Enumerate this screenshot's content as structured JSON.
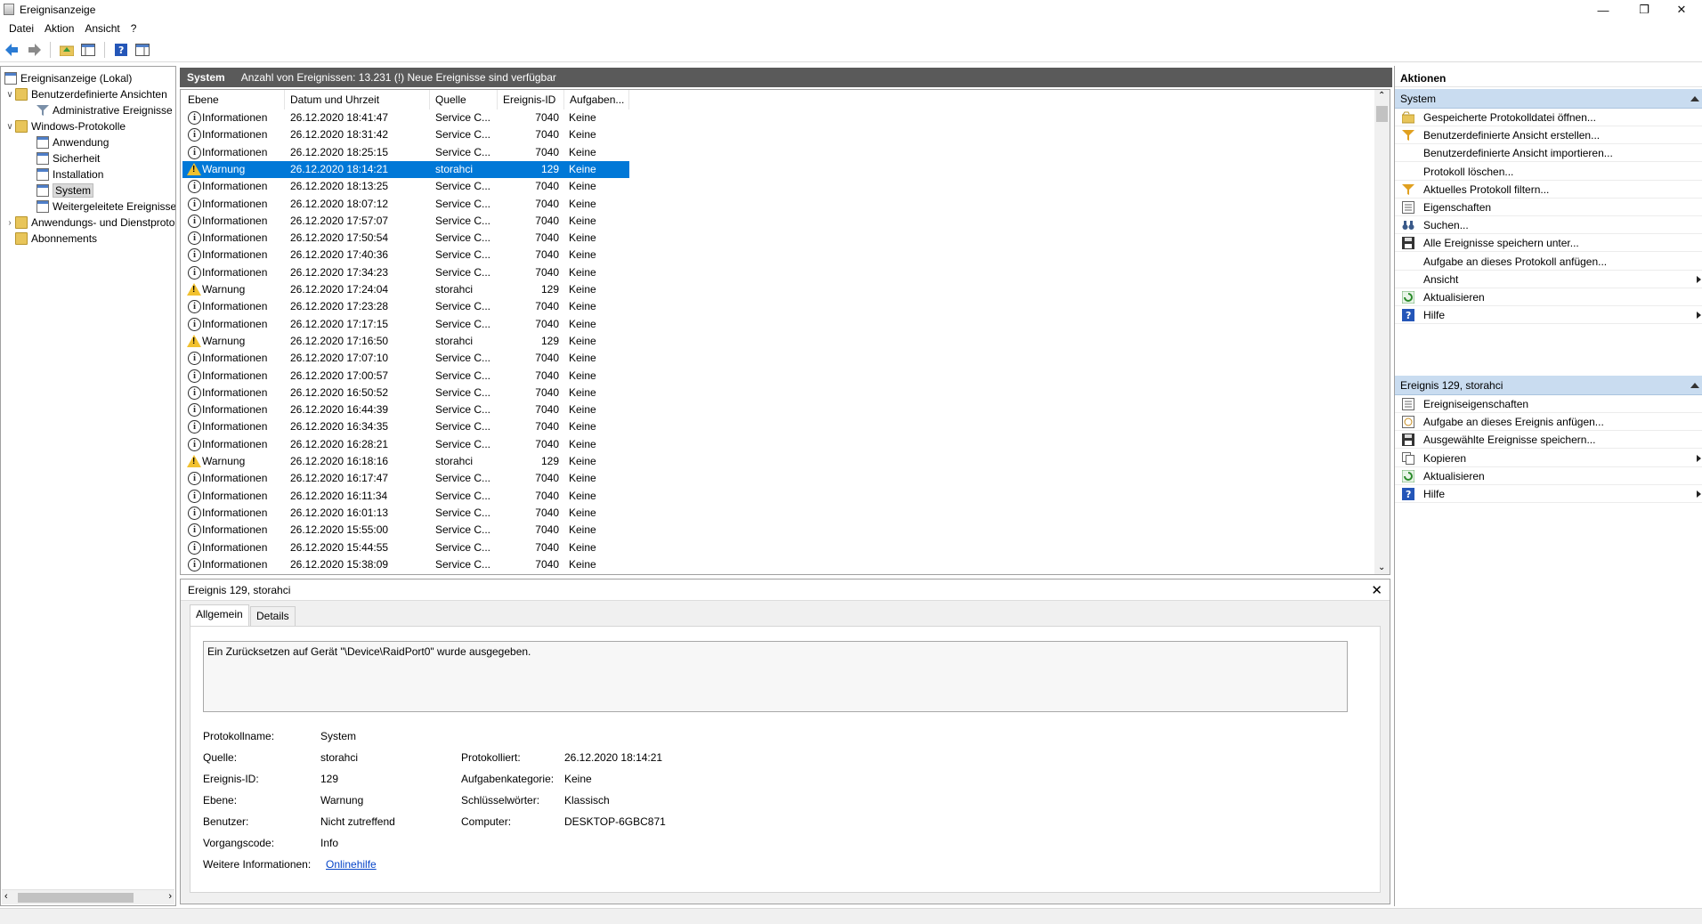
{
  "window": {
    "title": "Ereignisanzeige"
  },
  "menu": [
    "Datei",
    "Aktion",
    "Ansicht",
    "?"
  ],
  "tree": {
    "items": [
      {
        "label": "Ereignisanzeige (Lokal)"
      },
      {
        "label": "Benutzerdefinierte Ansichten"
      },
      {
        "label": "Administrative Ereignisse"
      },
      {
        "label": "Windows-Protokolle"
      },
      {
        "label": "Anwendung"
      },
      {
        "label": "Sicherheit"
      },
      {
        "label": "Installation"
      },
      {
        "label": "System"
      },
      {
        "label": "Weitergeleitete Ereignisse"
      },
      {
        "label": "Anwendungs- und Dienstprotokolle"
      },
      {
        "label": "Abonnements"
      }
    ]
  },
  "center": {
    "log_name": "System",
    "summary": "Anzahl von Ereignissen: 13.231 (!) Neue Ereignisse sind verfügbar"
  },
  "table": {
    "headers": [
      "Ebene",
      "Datum und Uhrzeit",
      "Quelle",
      "Ereignis-ID",
      "Aufgaben..."
    ],
    "rows": [
      {
        "level": "Informationen",
        "type": "info",
        "date": "26.12.2020 18:41:47",
        "source": "Service C...",
        "id": "7040",
        "task": "Keine"
      },
      {
        "level": "Informationen",
        "type": "info",
        "date": "26.12.2020 18:31:42",
        "source": "Service C...",
        "id": "7040",
        "task": "Keine"
      },
      {
        "level": "Informationen",
        "type": "info",
        "date": "26.12.2020 18:25:15",
        "source": "Service C...",
        "id": "7040",
        "task": "Keine"
      },
      {
        "level": "Warnung",
        "type": "warn",
        "date": "26.12.2020 18:14:21",
        "source": "storahci",
        "id": "129",
        "task": "Keine",
        "selected": true
      },
      {
        "level": "Informationen",
        "type": "info",
        "date": "26.12.2020 18:13:25",
        "source": "Service C...",
        "id": "7040",
        "task": "Keine"
      },
      {
        "level": "Informationen",
        "type": "info",
        "date": "26.12.2020 18:07:12",
        "source": "Service C...",
        "id": "7040",
        "task": "Keine"
      },
      {
        "level": "Informationen",
        "type": "info",
        "date": "26.12.2020 17:57:07",
        "source": "Service C...",
        "id": "7040",
        "task": "Keine"
      },
      {
        "level": "Informationen",
        "type": "info",
        "date": "26.12.2020 17:50:54",
        "source": "Service C...",
        "id": "7040",
        "task": "Keine"
      },
      {
        "level": "Informationen",
        "type": "info",
        "date": "26.12.2020 17:40:36",
        "source": "Service C...",
        "id": "7040",
        "task": "Keine"
      },
      {
        "level": "Informationen",
        "type": "info",
        "date": "26.12.2020 17:34:23",
        "source": "Service C...",
        "id": "7040",
        "task": "Keine"
      },
      {
        "level": "Warnung",
        "type": "warn",
        "date": "26.12.2020 17:24:04",
        "source": "storahci",
        "id": "129",
        "task": "Keine"
      },
      {
        "level": "Informationen",
        "type": "info",
        "date": "26.12.2020 17:23:28",
        "source": "Service C...",
        "id": "7040",
        "task": "Keine"
      },
      {
        "level": "Informationen",
        "type": "info",
        "date": "26.12.2020 17:17:15",
        "source": "Service C...",
        "id": "7040",
        "task": "Keine"
      },
      {
        "level": "Warnung",
        "type": "warn",
        "date": "26.12.2020 17:16:50",
        "source": "storahci",
        "id": "129",
        "task": "Keine"
      },
      {
        "level": "Informationen",
        "type": "info",
        "date": "26.12.2020 17:07:10",
        "source": "Service C...",
        "id": "7040",
        "task": "Keine"
      },
      {
        "level": "Informationen",
        "type": "info",
        "date": "26.12.2020 17:00:57",
        "source": "Service C...",
        "id": "7040",
        "task": "Keine"
      },
      {
        "level": "Informationen",
        "type": "info",
        "date": "26.12.2020 16:50:52",
        "source": "Service C...",
        "id": "7040",
        "task": "Keine"
      },
      {
        "level": "Informationen",
        "type": "info",
        "date": "26.12.2020 16:44:39",
        "source": "Service C...",
        "id": "7040",
        "task": "Keine"
      },
      {
        "level": "Informationen",
        "type": "info",
        "date": "26.12.2020 16:34:35",
        "source": "Service C...",
        "id": "7040",
        "task": "Keine"
      },
      {
        "level": "Informationen",
        "type": "info",
        "date": "26.12.2020 16:28:21",
        "source": "Service C...",
        "id": "7040",
        "task": "Keine"
      },
      {
        "level": "Warnung",
        "type": "warn",
        "date": "26.12.2020 16:18:16",
        "source": "storahci",
        "id": "129",
        "task": "Keine"
      },
      {
        "level": "Informationen",
        "type": "info",
        "date": "26.12.2020 16:17:47",
        "source": "Service C...",
        "id": "7040",
        "task": "Keine"
      },
      {
        "level": "Informationen",
        "type": "info",
        "date": "26.12.2020 16:11:34",
        "source": "Service C...",
        "id": "7040",
        "task": "Keine"
      },
      {
        "level": "Informationen",
        "type": "info",
        "date": "26.12.2020 16:01:13",
        "source": "Service C...",
        "id": "7040",
        "task": "Keine"
      },
      {
        "level": "Informationen",
        "type": "info",
        "date": "26.12.2020 15:55:00",
        "source": "Service C...",
        "id": "7040",
        "task": "Keine"
      },
      {
        "level": "Informationen",
        "type": "info",
        "date": "26.12.2020 15:44:55",
        "source": "Service C...",
        "id": "7040",
        "task": "Keine"
      },
      {
        "level": "Informationen",
        "type": "info",
        "date": "26.12.2020 15:38:09",
        "source": "Service C...",
        "id": "7040",
        "task": "Keine"
      }
    ]
  },
  "detail": {
    "title": "Ereignis 129, storahci",
    "tabs": [
      "Allgemein",
      "Details"
    ],
    "message": "Ein Zurücksetzen auf Gerät \"\\Device\\RaidPort0\" wurde ausgegeben.",
    "props": {
      "protokollname_label": "Protokollname:",
      "protokollname": "System",
      "quelle_label": "Quelle:",
      "quelle": "storahci",
      "protokolliert_label": "Protokolliert:",
      "protokolliert": "26.12.2020 18:14:21",
      "ereignisid_label": "Ereignis-ID:",
      "ereignisid": "129",
      "aufgabenkategorie_label": "Aufgabenkategorie:",
      "aufgabenkategorie": "Keine",
      "ebene_label": "Ebene:",
      "ebene": "Warnung",
      "schluesselwoerter_label": "Schlüsselwörter:",
      "schluesselwoerter": "Klassisch",
      "benutzer_label": "Benutzer:",
      "benutzer": "Nicht zutreffend",
      "computer_label": "Computer:",
      "computer": "DESKTOP-6GBC871",
      "vorgangscode_label": "Vorgangscode:",
      "vorgangscode": "Info",
      "weitere_label": "Weitere Informationen:",
      "weitere_link": "Onlinehilfe"
    }
  },
  "actions": {
    "title": "Aktionen",
    "section1": {
      "title": "System",
      "items": [
        {
          "label": "Gespeicherte Protokolldatei öffnen...",
          "icon": "folder-open-icon"
        },
        {
          "label": "Benutzerdefinierte Ansicht erstellen...",
          "icon": "filter-icon"
        },
        {
          "label": "Benutzerdefinierte Ansicht importieren...",
          "icon": ""
        },
        {
          "label": "Protokoll löschen...",
          "icon": ""
        },
        {
          "label": "Aktuelles Protokoll filtern...",
          "icon": "filter-icon"
        },
        {
          "label": "Eigenschaften",
          "icon": "properties-icon"
        },
        {
          "label": "Suchen...",
          "icon": "binoculars-icon"
        },
        {
          "label": "Alle Ereignisse speichern unter...",
          "icon": "save-icon"
        },
        {
          "label": "Aufgabe an dieses Protokoll anfügen...",
          "icon": ""
        },
        {
          "label": "Ansicht",
          "icon": "",
          "submenu": true
        },
        {
          "label": "Aktualisieren",
          "icon": "refresh-icon"
        },
        {
          "label": "Hilfe",
          "icon": "help-icon",
          "submenu": true
        }
      ]
    },
    "section2": {
      "title": "Ereignis 129, storahci",
      "items": [
        {
          "label": "Ereigniseigenschaften",
          "icon": "properties-icon"
        },
        {
          "label": "Aufgabe an dieses Ereignis anfügen...",
          "icon": "task-icon"
        },
        {
          "label": "Ausgewählte Ereignisse speichern...",
          "icon": "save-icon"
        },
        {
          "label": "Kopieren",
          "icon": "copy-icon",
          "submenu": true
        },
        {
          "label": "Aktualisieren",
          "icon": "refresh-icon"
        },
        {
          "label": "Hilfe",
          "icon": "help-icon",
          "submenu": true
        }
      ]
    }
  },
  "colors": {
    "selection": "#0078d7",
    "header_dark": "#5a5a5a",
    "section_blue": "#c9dcf0"
  }
}
